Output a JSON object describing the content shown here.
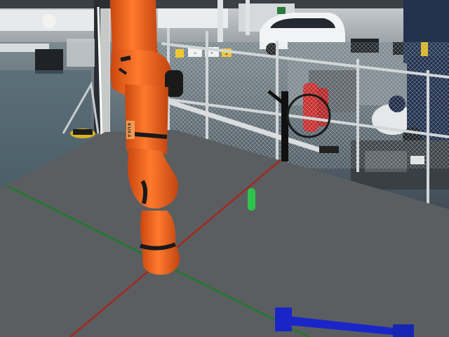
{
  "scene": {
    "robot_label": "KUKA",
    "signs": [
      "⚠",
      "≡",
      "▲"
    ],
    "colors": {
      "robot_orange": "#f0621d",
      "robot_joint": "#2b2b2b",
      "floor": "#5b5e61",
      "axis_x": "#a3281f",
      "axis_y": "#1f7a2a",
      "target_marker": "#2fc24a",
      "gripper": "#1a25c8",
      "post": "#101010"
    },
    "icons": [
      "floor-grid",
      "axis-x-line",
      "axis-y-line",
      "target-marker",
      "gripper-tool",
      "robot-arm",
      "background-photo"
    ]
  }
}
